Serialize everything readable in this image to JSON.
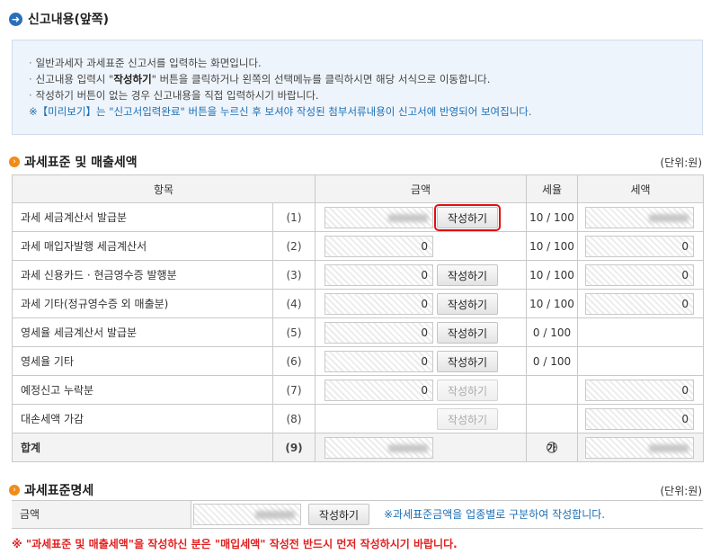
{
  "header": {
    "icon": "arrow-circle-icon",
    "title": "신고내용(앞쪽)"
  },
  "info": {
    "lines": [
      "일반과세자 과세표준 신고서를 입력하는 화면입니다.",
      "버튼을 클릭하거나 왼쪽의 선택메뉴를 클릭하시면 해당 서식으로 이동합니다.",
      "작성하기 버튼이 없는 경우 신고내용을 직접 입력하시기 바랍니다."
    ],
    "line2_prefix": "신고내용 입력시 \"",
    "line2_em": "작성하기",
    "line2_suffix": "\" 버튼을 클릭하거나 왼쪽의 선택메뉴를 클릭하시면 해당 서식으로 이동합니다.",
    "note": "※【미리보기】는 \"신고서입력완료\" 버튼을 누르신 후 보셔야 작성된 첨부서류내용이 신고서에 반영되어 보여집니다."
  },
  "section1": {
    "title": "과세표준 및 매출세액",
    "unit": "(단위:원)",
    "headers": {
      "item": "항목",
      "amount": "금액",
      "rate": "세율",
      "tax": "세액"
    },
    "button_label": "작성하기",
    "rows": [
      {
        "label": "과세 세금계산서 발급분",
        "num": "(1)",
        "amount": "",
        "amount_masked": true,
        "rate": "10 / 100",
        "tax": "",
        "tax_masked": true
      },
      {
        "label": "과세 매입자발행 세금계산서",
        "num": "(2)",
        "amount": "0",
        "rate": "10 / 100",
        "tax": "0"
      },
      {
        "label": "과세 신용카드 · 현금영수증 발행분",
        "num": "(3)",
        "amount": "0",
        "rate": "10 / 100",
        "tax": "0"
      },
      {
        "label": "과세 기타(정규영수증 외 매출분)",
        "num": "(4)",
        "amount": "0",
        "rate": "10 / 100",
        "tax": "0"
      },
      {
        "label": "영세율 세금계산서 발급분",
        "num": "(5)",
        "amount": "0",
        "rate": "0 / 100",
        "tax": ""
      },
      {
        "label": "영세율 기타",
        "num": "(6)",
        "amount": "0",
        "rate": "0 / 100",
        "tax": ""
      },
      {
        "label": "예정신고 누락분",
        "num": "(7)",
        "amount": "0",
        "rate": "",
        "tax": "0"
      },
      {
        "label": "대손세액 가감",
        "num": "(8)",
        "amount": "",
        "rate": "",
        "tax": "0"
      }
    ],
    "total": {
      "label": "합계",
      "num": "(9)",
      "rate_symbol": "㉮"
    }
  },
  "section2": {
    "title": "과세표준명세",
    "unit": "(단위:원)",
    "row_label": "금액",
    "button_label": "작성하기",
    "note": "※과세표준금액을 업종별로 구분하여 작성합니다."
  },
  "footer": {
    "warning": "※ \"과세표준 및 매출세액\"을 작성하신 분은 \"매입세액\" 작성전 반드시 먼저 작성하시기 바랍니다."
  },
  "colors": {
    "accent_blue": "#2a6fb8",
    "note_blue": "#1b6fb5",
    "warning_red": "#e02020",
    "bullet_orange": "#f08c1a"
  }
}
